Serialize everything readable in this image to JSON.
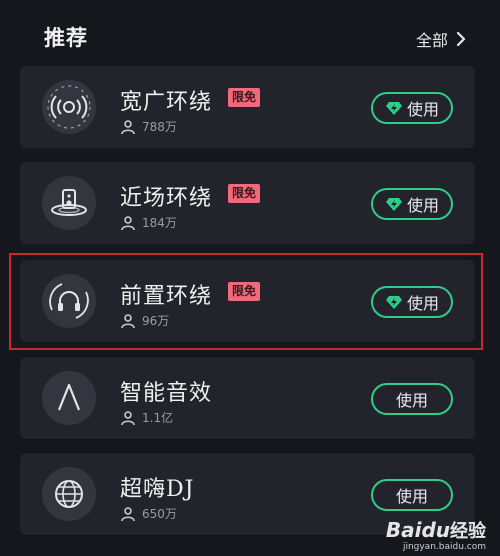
{
  "header": {
    "title": "推荐",
    "all_label": "全部"
  },
  "items": [
    {
      "title": "宽广环绕",
      "badge": "限免",
      "count": "788万",
      "button": "使用",
      "icon": "wide-surround-icon"
    },
    {
      "title": "近场环绕",
      "badge": "限免",
      "count": "184万",
      "button": "使用",
      "icon": "speaker-surround-icon"
    },
    {
      "title": "前置环绕",
      "badge": "限免",
      "count": "96万",
      "button": "使用",
      "icon": "headphone-surround-icon"
    },
    {
      "title": "智能音效",
      "badge": "",
      "count": "1.1亿",
      "button": "使用",
      "icon": "smart-a-icon"
    },
    {
      "title": "超嗨DJ",
      "badge": "",
      "count": "650万",
      "button": "使用",
      "icon": "globe-icon"
    }
  ],
  "colors": {
    "background": "#16171d",
    "card": "#22232b",
    "accent_green": "#2fcc8a",
    "badge_red": "#ef6b7b",
    "highlight_red": "#c9272d"
  },
  "watermark": {
    "brand": "Baidu",
    "brand_cn": "经验",
    "url": "jingyan.baidu.com"
  }
}
